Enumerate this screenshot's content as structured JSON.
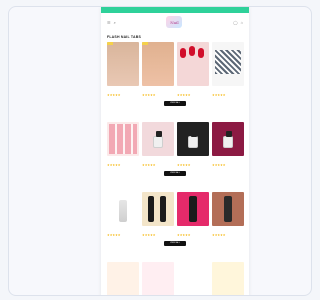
{
  "top_bar": {
    "text": ""
  },
  "header": {
    "logo_text": "Nail"
  },
  "section1": {
    "title": "FLASH NAIL TABS"
  },
  "view_all_label": "VIEW ALL",
  "products_row1": [
    {
      "name": "",
      "price": ""
    },
    {
      "name": "",
      "price": ""
    },
    {
      "name": "",
      "price": ""
    },
    {
      "name": "",
      "price": ""
    }
  ],
  "colors": {
    "accent_bar": "#2fd19a",
    "button": "#111111",
    "badge": "#f5d14a"
  }
}
